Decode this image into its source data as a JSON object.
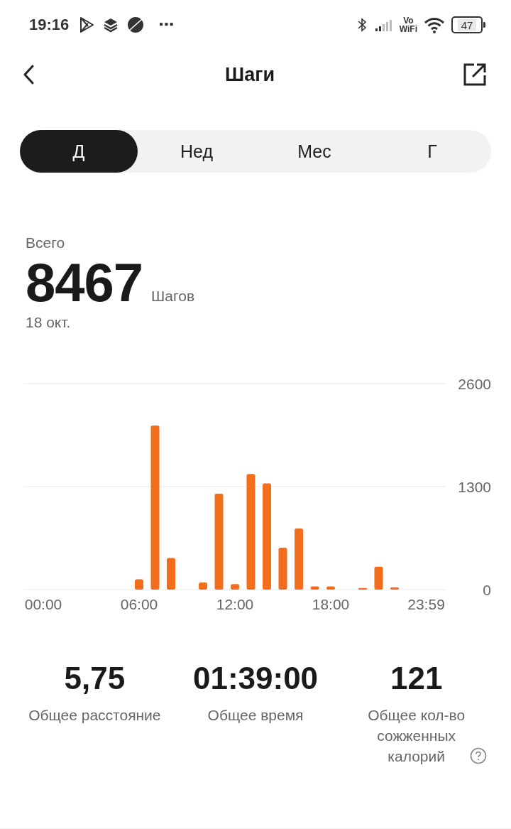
{
  "status_bar": {
    "time": "19:16",
    "more": "⋯",
    "vowifi": [
      "Vo",
      "WiFi"
    ],
    "battery": "47"
  },
  "header": {
    "title": "Шаги"
  },
  "tabs": [
    {
      "label": "Д",
      "selected": true
    },
    {
      "label": "Нед",
      "selected": false
    },
    {
      "label": "Мес",
      "selected": false
    },
    {
      "label": "Г",
      "selected": false
    }
  ],
  "summary": {
    "label": "Всего",
    "value": "8467",
    "unit": "Шагов",
    "date": "18 окт."
  },
  "chart_data": {
    "type": "bar",
    "x": [
      6,
      7,
      8,
      10,
      11,
      12,
      13,
      14,
      15,
      16,
      17,
      18,
      20,
      21,
      22
    ],
    "series": [
      {
        "color": "#f26d1c",
        "values": [
          130,
          2070,
          400,
          90,
          1210,
          70,
          1460,
          1340,
          530,
          770,
          40,
          40,
          20,
          290,
          30
        ]
      }
    ],
    "xlim": [
      -1.2,
      25.2
    ],
    "ylim": [
      0,
      2600
    ],
    "xticks": [
      {
        "value": 0,
        "label": "00:00"
      },
      {
        "value": 6,
        "label": "06:00"
      },
      {
        "value": 12,
        "label": "12:00"
      },
      {
        "value": 18,
        "label": "18:00"
      },
      {
        "value": 23.98,
        "label": "23:59"
      }
    ],
    "yticks": [
      0,
      1300,
      2600
    ]
  },
  "stats": [
    {
      "value": "5,75",
      "label": "Общее расстояние",
      "help": false
    },
    {
      "value": "01:39:00",
      "label": "Общее время",
      "help": false
    },
    {
      "value": "121",
      "label": "Общее кол-во сожженных калорий",
      "help": true
    }
  ]
}
